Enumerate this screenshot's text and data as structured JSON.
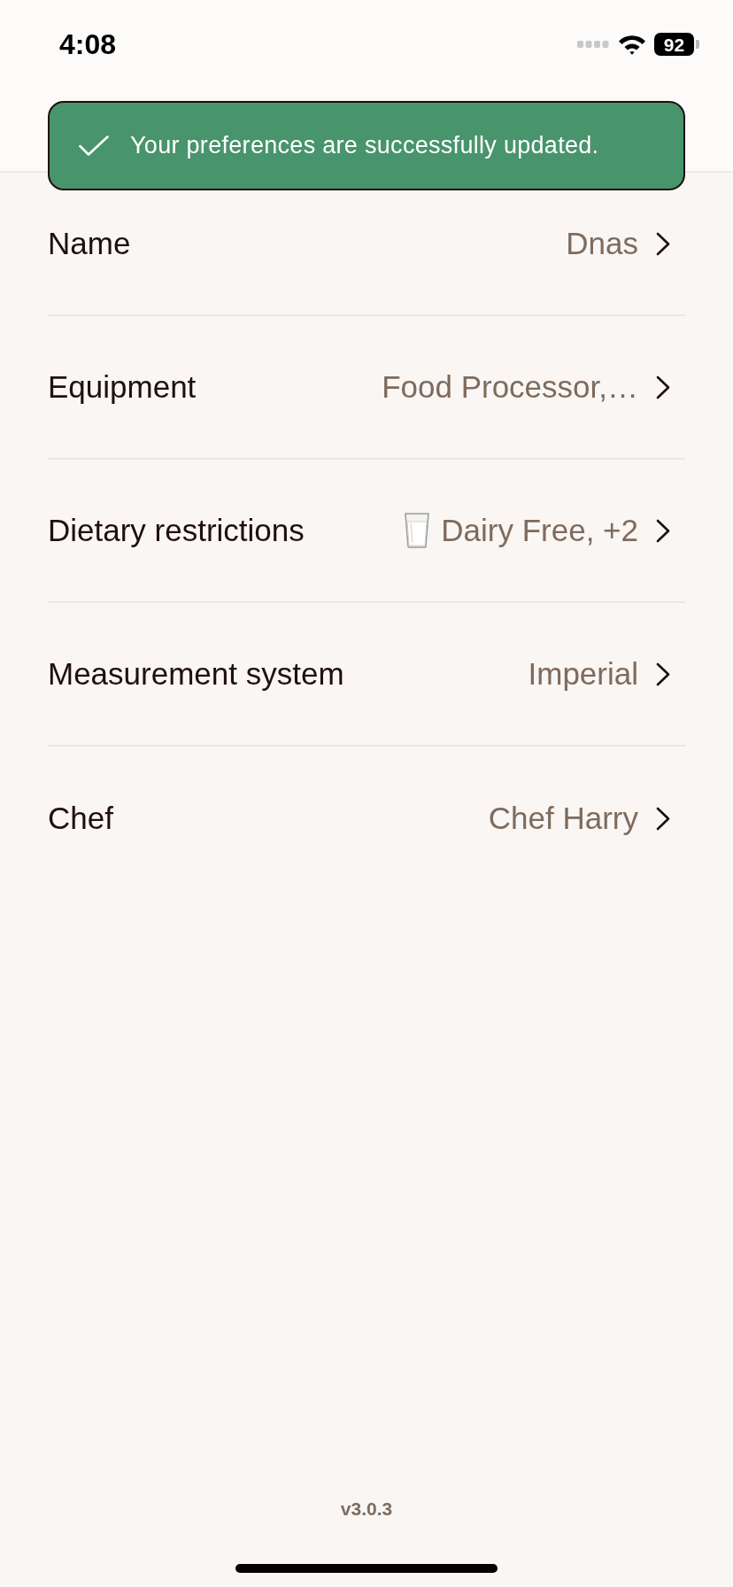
{
  "status_bar": {
    "time": "4:08",
    "battery": "92"
  },
  "toast": {
    "message": "Your preferences are successfully updated."
  },
  "settings": [
    {
      "label": "Name",
      "value": "Dnas",
      "kind": "text"
    },
    {
      "label": "Equipment",
      "value": "Food Processor,…",
      "kind": "text"
    },
    {
      "label": "Dietary restrictions",
      "value": "Dairy Free, +2",
      "kind": "icon-text"
    },
    {
      "label": "Measurement system",
      "value": "Imperial",
      "kind": "text"
    },
    {
      "label": "Chef",
      "value": "Chef Harry",
      "kind": "text"
    }
  ],
  "footer": {
    "version": "v3.0.3"
  }
}
